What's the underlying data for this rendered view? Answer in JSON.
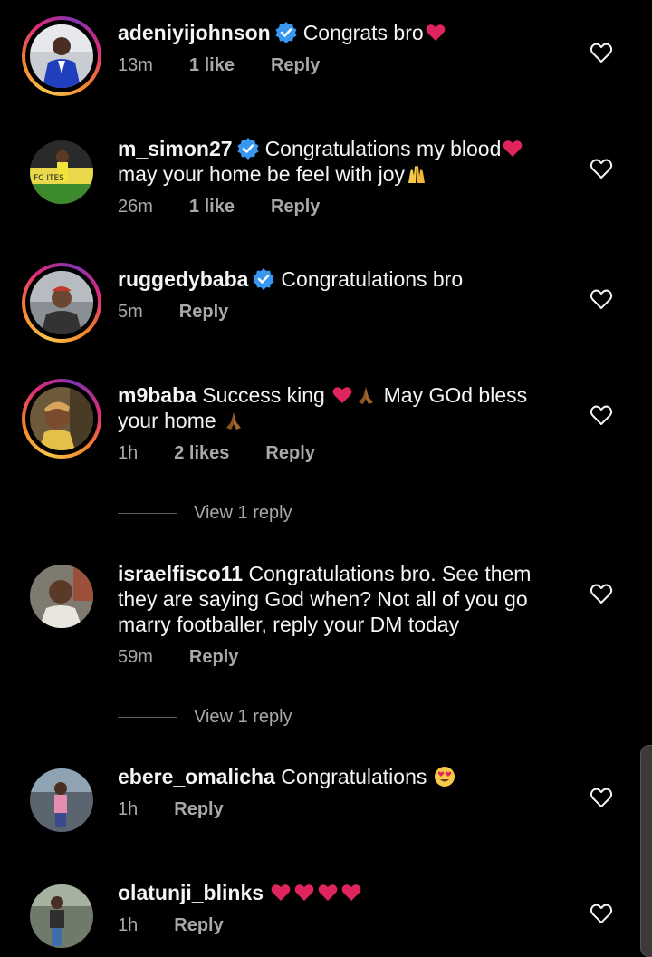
{
  "colors": {
    "background": "#000000",
    "text": "#f5f5f5",
    "secondary": "#a8a8a8",
    "verified": "#3897f0",
    "heart_emoji": "#e0245e"
  },
  "icons": {
    "verified": "verified-badge-icon",
    "like": "heart-outline-icon",
    "red_heart": "red-heart-emoji",
    "praying": "folded-hands-emoji",
    "raised": "raising-hands-emoji",
    "heart_eyes": "heart-eyes-emoji"
  },
  "comments": [
    {
      "username": "adeniyijohnson",
      "verified": true,
      "text": "Congrats bro",
      "time": "13m",
      "likes": "1 like",
      "reply": "Reply"
    },
    {
      "username": "m_simon27",
      "verified": true,
      "text": "Congratulations my blood",
      "text2": "may your home be feel with joy",
      "time": "26m",
      "likes": "1 like",
      "reply": "Reply"
    },
    {
      "username": "ruggedybaba",
      "verified": true,
      "text": "Congratulations bro",
      "time": "5m",
      "reply": "Reply"
    },
    {
      "username": "m9baba",
      "verified": false,
      "text": "Success king",
      "text_mid": "May GOd bless",
      "text2": "your home",
      "time": "1h",
      "likes": "2 likes",
      "reply": "Reply",
      "view_replies": "View 1 reply"
    },
    {
      "username": "israelfisco11",
      "verified": false,
      "text": "Congratulations bro. See them",
      "text2": "they are saying God when? Not all of you go",
      "text3": "marry footballer, reply your DM today",
      "time": "59m",
      "reply": "Reply",
      "view_replies": "View 1 reply"
    },
    {
      "username": "ebere_omalicha",
      "verified": false,
      "text": "Congratulations",
      "time": "1h",
      "reply": "Reply"
    },
    {
      "username": "olatunji_blinks",
      "verified": false,
      "text": "",
      "time": "1h",
      "reply": "Reply"
    }
  ]
}
